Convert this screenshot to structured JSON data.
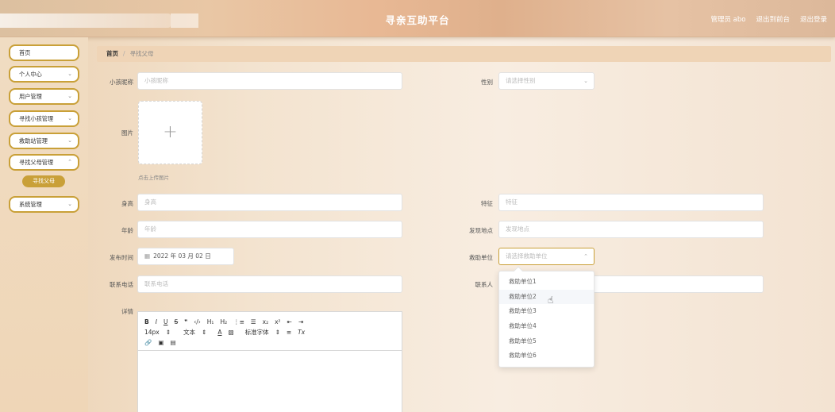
{
  "header": {
    "title": "寻亲互助平台",
    "admin_label": "管理员 abo",
    "back_label": "退出到前台",
    "logout_label": "退出登录"
  },
  "sidebar": {
    "items": [
      {
        "label": "首页",
        "has_arrow": false
      },
      {
        "label": "个人中心",
        "has_arrow": true
      },
      {
        "label": "用户管理",
        "has_arrow": true
      },
      {
        "label": "寻找小孩管理",
        "has_arrow": true
      },
      {
        "label": "救助站管理",
        "has_arrow": true
      },
      {
        "label": "寻找父母管理",
        "has_arrow": true
      },
      {
        "label": "系统管理",
        "has_arrow": true
      }
    ],
    "sub_item": "寻找父母",
    "active_color": "#c9a038"
  },
  "breadcrumb": {
    "home": "首页",
    "separator": "/",
    "current": "寻找父母"
  },
  "form": {
    "nickname": {
      "label": "小孩昵称",
      "placeholder": "小孩昵称"
    },
    "gender": {
      "label": "性别",
      "placeholder": "请选择性别"
    },
    "image": {
      "label": "图片",
      "tip": "点击上传图片"
    },
    "height": {
      "label": "身高",
      "placeholder": "身高"
    },
    "feature": {
      "label": "特征",
      "placeholder": "特征"
    },
    "age": {
      "label": "年龄",
      "placeholder": "年龄"
    },
    "found_place": {
      "label": "发现地点",
      "placeholder": "发现地点"
    },
    "publish_time": {
      "label": "发布时间",
      "value": "2022 年 03 月 02 日"
    },
    "rescue_unit": {
      "label": "救助单位",
      "placeholder": "请选择救助单位"
    },
    "phone": {
      "label": "联系电话",
      "placeholder": "联系电话"
    },
    "contact": {
      "label": "联系人"
    },
    "details": {
      "label": "详情"
    }
  },
  "editor": {
    "row1": [
      "B",
      "I",
      "U",
      "S",
      "❞",
      "‹/›",
      "H₁",
      "H₂",
      "⋮≡",
      "☰",
      "x₂",
      "x²",
      "⇤",
      "⇥"
    ],
    "row2": [
      "14px",
      "⇕",
      "文本",
      "⇕",
      "A",
      "▧",
      "标准字体",
      "⇕",
      "≡",
      "Tx"
    ],
    "row3": [
      "🔗",
      "▣",
      "▤"
    ]
  },
  "dropdown": {
    "options": [
      "救助单位1",
      "救助单位2",
      "救助单位3",
      "救助单位4",
      "救助单位5",
      "救助单位6"
    ],
    "hovered_index": 1
  }
}
